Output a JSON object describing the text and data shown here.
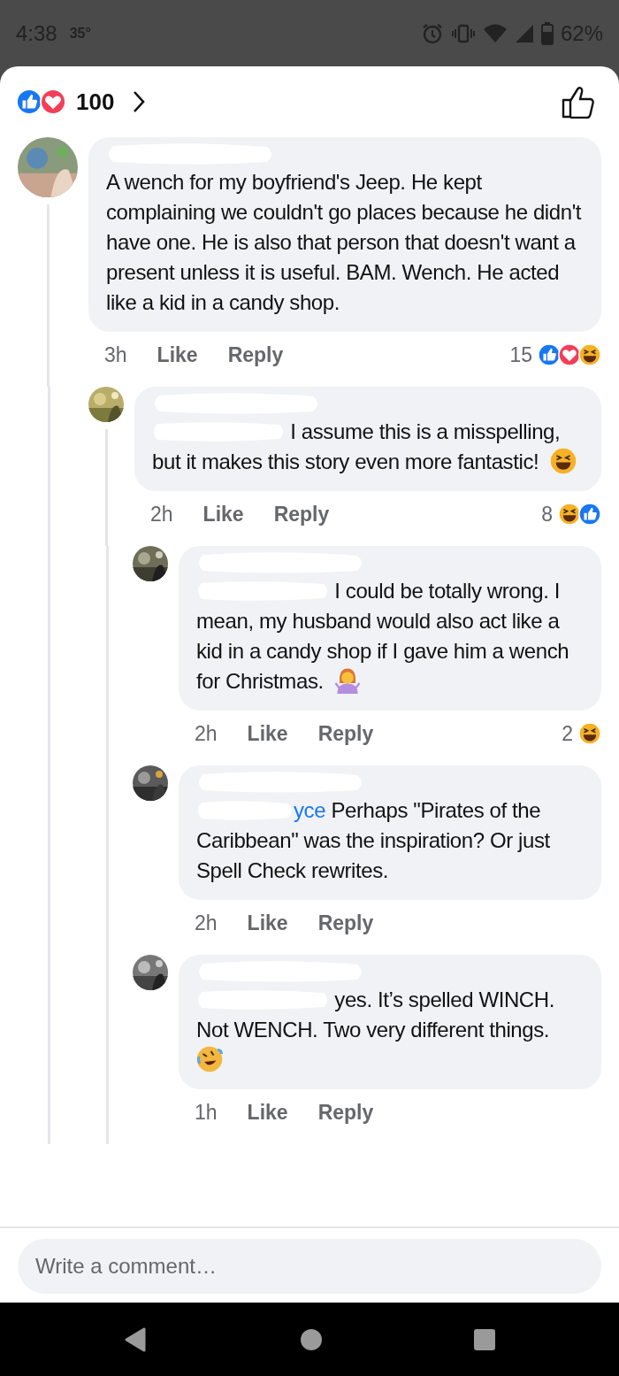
{
  "status_bar": {
    "time": "4:38",
    "temperature": "35°",
    "battery": "62%"
  },
  "header": {
    "reactions": [
      {
        "kind": "like"
      },
      {
        "kind": "love"
      }
    ],
    "count": "100"
  },
  "comments": [
    {
      "text": "A wench for my boyfriend's Jeep. He kept complaining we couldn't go places because he didn't have one. He is also that person that doesn't want a present unless it is useful. BAM. Wench. He acted like a kid in a candy shop.",
      "time": "3h",
      "like": "Like",
      "reply": "Reply",
      "reaction_count": "15",
      "reactions": [
        {
          "kind": "like"
        },
        {
          "kind": "love"
        },
        {
          "kind": "haha"
        }
      ],
      "children": [
        {
          "mention": {
            "kind": "redacted"
          },
          "text": "I assume this is a misspelling, but it makes this story even more fantastic!",
          "emoji": {
            "kind": "haha"
          },
          "time": "2h",
          "like": "Like",
          "reply": "Reply",
          "reaction_count": "8",
          "reactions": [
            {
              "kind": "haha"
            },
            {
              "kind": "like"
            }
          ],
          "children": [
            {
              "mention": {
                "kind": "redacted"
              },
              "text": "I could be totally wrong.  I mean, my husband would also act like a kid in a candy shop if I gave him a wench for Christmas.",
              "emoji": {
                "kind": "shrug"
              },
              "time": "2h",
              "like": "Like",
              "reply": "Reply",
              "reaction_count": "2",
              "reactions": [
                {
                  "kind": "haha"
                }
              ]
            },
            {
              "mention": {
                "kind": "partial",
                "text": "yce"
              },
              "text": "Perhaps \"Pirates of the Caribbean\" was the inspiration? Or just Spell Check rewrites.",
              "time": "2h",
              "like": "Like",
              "reply": "Reply"
            },
            {
              "mention": {
                "kind": "redacted"
              },
              "text": "yes.  It’s spelled WINCH.  Not WENCH.  Two very different things.",
              "emoji": {
                "kind": "rofl"
              },
              "time": "1h",
              "like": "Like",
              "reply": "Reply"
            }
          ]
        }
      ]
    }
  ],
  "composer": {
    "placeholder": "Write a comment…"
  }
}
